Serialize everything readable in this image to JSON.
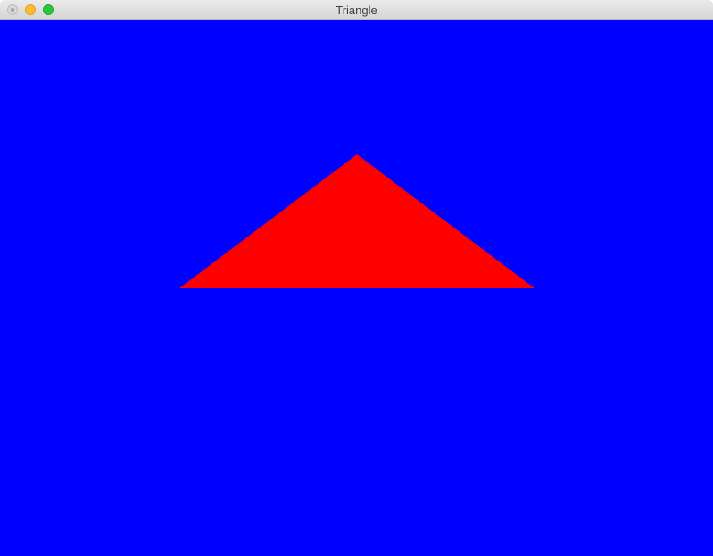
{
  "window": {
    "title": "Triangle"
  },
  "icons": {
    "close": "close-icon",
    "minimize": "minimize-icon",
    "zoom": "zoom-icon"
  },
  "colors": {
    "background": "#0000ff",
    "triangle": "#ff0000",
    "close_button": "#d8d8d8",
    "minimize_button": "#febc2e",
    "zoom_button": "#29c73f"
  }
}
